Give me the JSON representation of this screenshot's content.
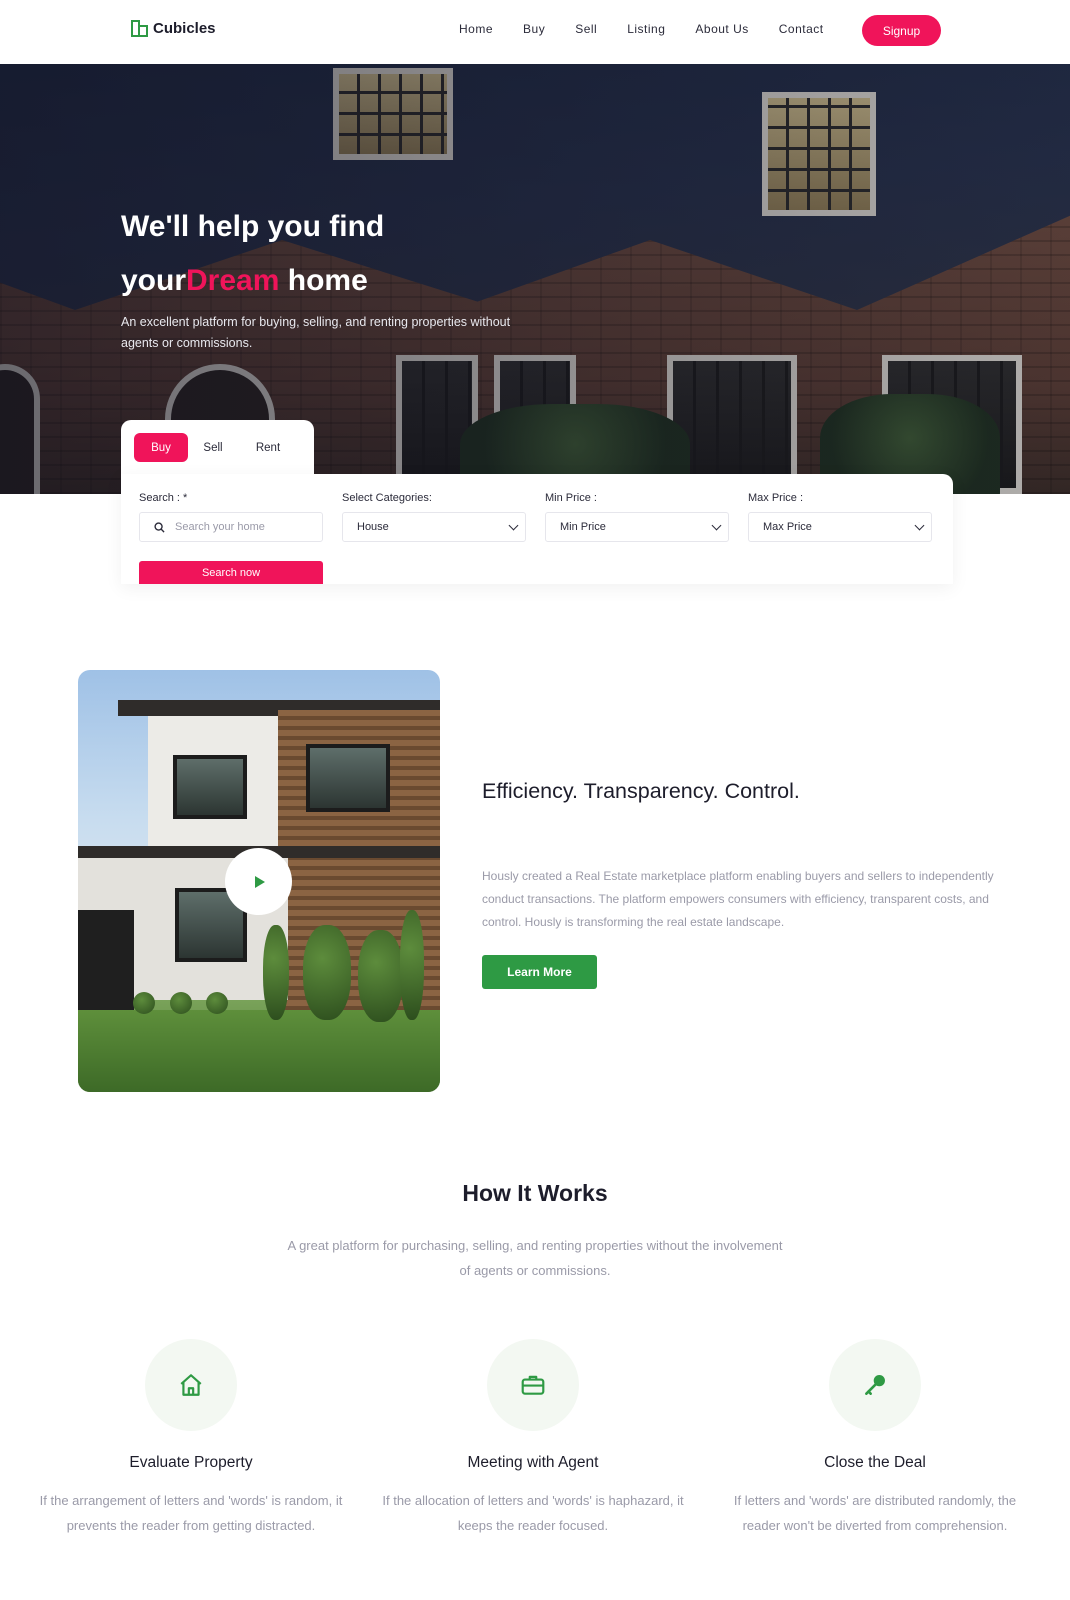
{
  "brand": {
    "name": "Cubicles",
    "accent": "#f0145a",
    "green": "#2e9a44"
  },
  "nav": {
    "links": [
      "Home",
      "Buy",
      "Sell",
      "Listing",
      "About Us",
      "Contact"
    ],
    "signup_label": "Signup"
  },
  "hero": {
    "title_line1": "We'll help you find",
    "title_line2_pre": "your",
    "title_line2_accent": "Dream",
    "title_line2_post": " home",
    "subtitle": "An excellent platform for buying, selling, and renting properties without agents or commissions."
  },
  "search": {
    "tabs": [
      "Buy",
      "Sell",
      "Rent"
    ],
    "active_tab": "Buy",
    "fields": {
      "search": {
        "label": "Search : *",
        "placeholder": "Search your home",
        "icon": "search-icon"
      },
      "category": {
        "label": "Select Categories:",
        "value": "House"
      },
      "min_price": {
        "label": "Min Price :",
        "value": "Min Price"
      },
      "max_price": {
        "label": "Max Price :",
        "value": "Max Price"
      }
    },
    "button_label": "Search now"
  },
  "feature": {
    "title": "Efficiency. Transparency. Control.",
    "text": "Hously created a Real Estate marketplace platform enabling buyers and sellers to independently conduct transactions. The platform empowers consumers with efficiency, transparent costs, and control. Hously is transforming the real estate landscape.",
    "button_label": "Learn More",
    "play_icon": "play-icon"
  },
  "how_it_works": {
    "title": "How It Works",
    "subtitle": "A great platform for purchasing, selling, and renting properties without the involvement of agents or commissions.",
    "steps": [
      {
        "icon": "home-icon",
        "title": "Evaluate Property",
        "text": "If the arrangement of letters and 'words' is random, it prevents the reader from getting distracted."
      },
      {
        "icon": "briefcase-icon",
        "title": "Meeting with Agent",
        "text": "If the allocation of letters and 'words' is haphazard, it keeps the reader focused."
      },
      {
        "icon": "key-icon",
        "title": "Close the Deal",
        "text": "If letters and 'words' are distributed randomly, the reader won't be diverted from comprehension."
      }
    ]
  }
}
